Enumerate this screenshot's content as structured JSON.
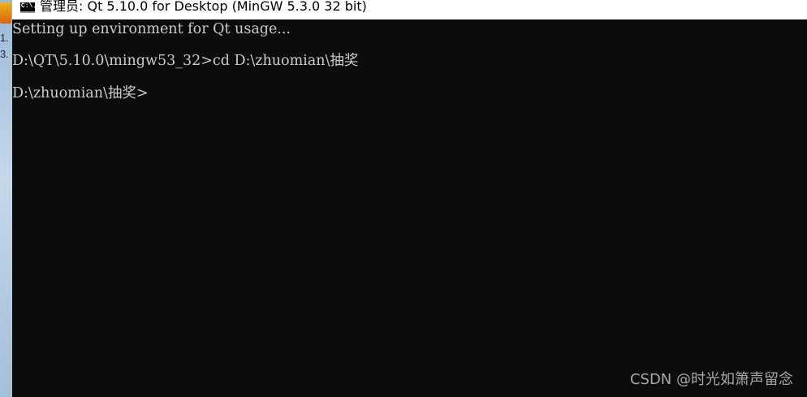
{
  "window": {
    "title": "管理员: Qt 5.10.0 for Desktop (MinGW 5.3.0 32 bit)",
    "icon": "console-icon",
    "icon_text": "C:\\."
  },
  "desktop": {
    "labels": [
      "1.",
      "3."
    ]
  },
  "console": {
    "lines": [
      "Setting up environment for Qt usage...",
      "D:\\QT\\5.10.0\\mingw53_32>cd D:\\zhuomian\\抽奖",
      "D:\\zhuomian\\抽奖>"
    ]
  },
  "watermark": "CSDN @时光如箫声留念",
  "colors": {
    "console_bg": "#0c0c0c",
    "console_text": "#cccccc",
    "titlebar_bg": "#ffffff"
  }
}
